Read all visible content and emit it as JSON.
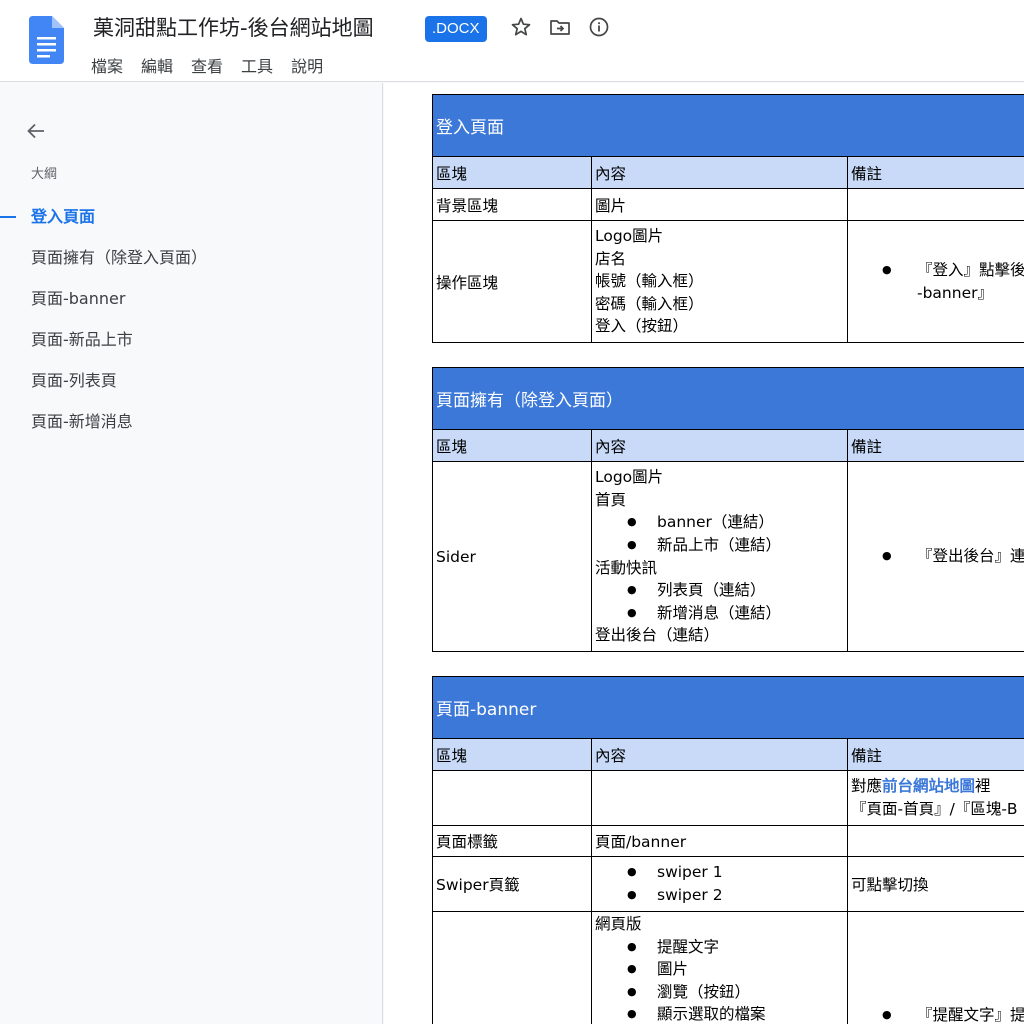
{
  "header": {
    "doc_title": "菓洞甜點工作坊-後台網站地圖",
    "badge": ".DOCX",
    "menu": [
      "檔案",
      "編輯",
      "查看",
      "工具",
      "說明"
    ],
    "icons": [
      "star-icon",
      "move-to-folder-icon",
      "info-icon"
    ]
  },
  "sidebar": {
    "outline_label": "大綱",
    "items": [
      {
        "label": "登入頁面",
        "active": true
      },
      {
        "label": "頁面擁有（除登入頁面）"
      },
      {
        "label": "頁面-banner"
      },
      {
        "label": "頁面-新品上市"
      },
      {
        "label": "頁面-列表頁"
      },
      {
        "label": "頁面-新增消息"
      }
    ]
  },
  "sections": [
    {
      "title": "登入頁面",
      "headers": [
        "區塊",
        "內容",
        "備註"
      ],
      "rows": [
        {
          "block": "背景區塊",
          "content": [
            "圖片"
          ],
          "note": ""
        },
        {
          "block": "操作區塊",
          "content": [
            "Logo圖片",
            "店名",
            "帳號（輸入框）",
            "密碼（輸入框）",
            "登入（按鈕）"
          ],
          "note_bullet": [
            "『登入』點擊後",
            "-banner』"
          ]
        }
      ]
    },
    {
      "title": "頁面擁有（除登入頁面）",
      "headers": [
        "區塊",
        "內容",
        "備註"
      ],
      "rows": [
        {
          "block": "Sider",
          "content": [
            "Logo圖片",
            "首頁"
          ],
          "content_bullets1": [
            "banner（連結）",
            "新品上市（連結）"
          ],
          "content_mid": "活動快訊",
          "content_bullets2": [
            "列表頁（連結）",
            "新增消息（連結）"
          ],
          "content_end": "登出後台（連結）",
          "note_bullet": [
            "『登出後台』連"
          ]
        }
      ]
    },
    {
      "title": "頁面-banner",
      "headers": [
        "區塊",
        "內容",
        "備註"
      ],
      "rows": [
        {
          "block": "",
          "content": [],
          "note_prefix": "對應",
          "note_link": "前台網站地圖",
          "note_suffix": "裡",
          "note_line2": "『頁面-首頁』/『區塊-B"
        },
        {
          "block": "頁面標籤",
          "content": [
            "頁面/banner"
          ],
          "note": ""
        },
        {
          "block": "Swiper頁籤",
          "content_bullets": [
            "swiper 1",
            "swiper 2"
          ],
          "note": "可點擊切換"
        },
        {
          "block": "",
          "content": [
            "網頁版"
          ],
          "content_bullets": [
            "提醒文字",
            "圖片",
            "瀏覽（按鈕）",
            "顯示選取的檔案"
          ],
          "note_bullet": [
            "『提醒文字』提"
          ]
        }
      ]
    }
  ]
}
